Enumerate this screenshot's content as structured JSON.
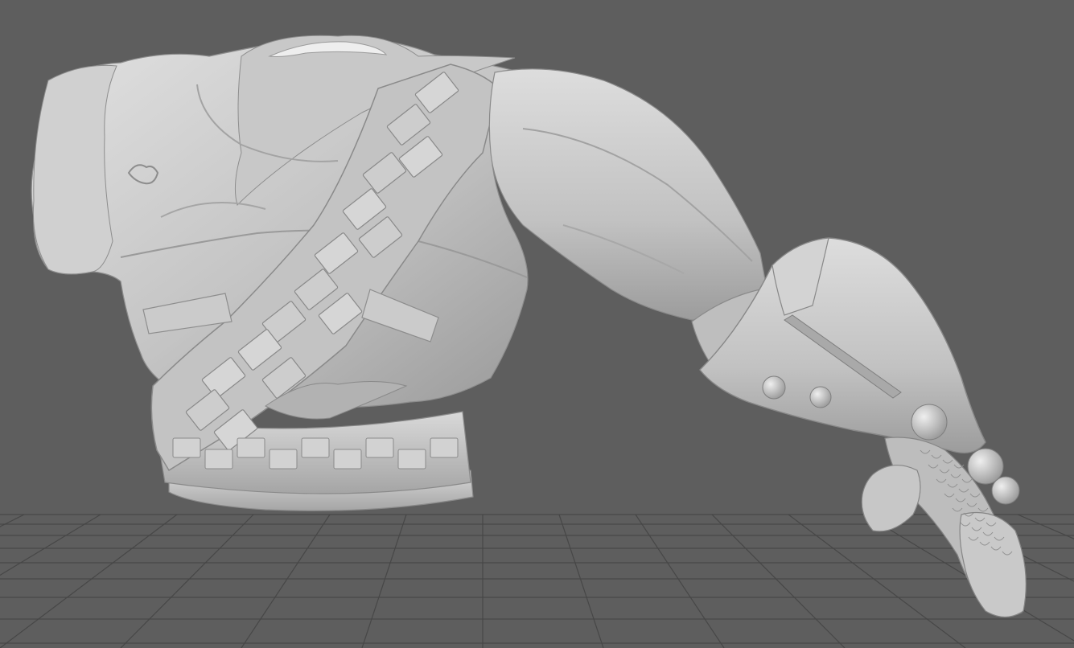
{
  "viewport": {
    "background": "#5e5e5e",
    "grid_color": "#474747",
    "model_color": "#c9c9c9",
    "model_shadow_color": "#8d8d8d",
    "model_highlight_color": "#e6e6e6",
    "grid_visible": true,
    "model_name": "",
    "icons": [
      "torso-mesh",
      "arm-mesh",
      "gauntlet-mesh",
      "hand-mesh",
      "floor-grid"
    ]
  }
}
